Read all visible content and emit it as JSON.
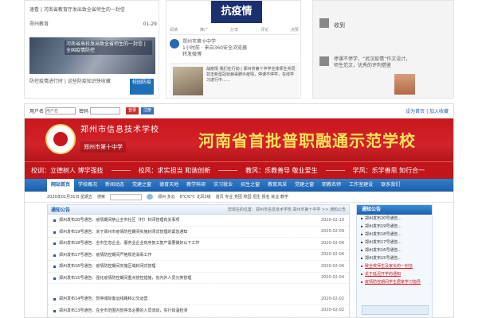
{
  "collage": {
    "panel1": {
      "news1_title": "速看 | 河南省教育厅发出致全省师生的一封信",
      "news1_meta_left": "郑州教育",
      "news1_meta_right": "01-29",
      "photo_caption": "河南省高校发出致全省师生的一封信 | 全国疫情防控",
      "news2_title": "防控疫情进行时 | 这些防疫知识快收藏",
      "thumb_label": "校园防疫"
    },
    "panel2": {
      "banner_text": "抗疫情",
      "actions": [
        "阅读",
        "推广",
        "分享",
        "评论",
        "点赞"
      ],
      "post_name": "郑州市第十中学",
      "post_meta": "1小时前 · 来自360安全浏览器",
      "post_sub": "转发微博",
      "content_text": "战疫情 我们在行动 | 郑州市第十中学全体师生共同抗击新型冠状病毒肺炎疫情，停课不停学，在线学习进行中……"
    },
    "panel3": {
      "chat1": "收到",
      "chat2": "停课不停学，“武汉疫情”作文设计，师生范文，优秀的评判借鉴"
    }
  },
  "site": {
    "loginbar": {
      "user_label": "用户名",
      "user_placeholder": "用户名",
      "pass_label": "密码",
      "login_btn": "登录",
      "register_btn": "注册",
      "right_links": "设为首页 | 加入收藏"
    },
    "header": {
      "school_name": "郑州市信息技术学校",
      "school_sub": "郑州市第十中学",
      "slogan": "河南省首批普职融通示范学校"
    },
    "motto": {
      "school_motto": "校训：立德树人  博学强技",
      "school_style": "校风：求实担当  和谐创新",
      "teach_style": "教风：乐教善导  敬业爱生",
      "study_style": "学风：乐学善思  知行合一"
    },
    "nav": [
      "网站首页",
      "学校概况",
      "新闻动态",
      "党建之窗",
      "德育天地",
      "教学科研",
      "实习就业",
      "招生之窗",
      "教育风采",
      "党建之窗",
      "职教名师",
      "工作室建设",
      "联系我们"
    ],
    "infobar": {
      "date": "2020年01月31日 星期五",
      "search_label": "搜索",
      "weather": "郑州 多云",
      "temp": "8℃/0℃ 北风3级",
      "links": "首页  专业  党团  校园  招生  报名  就业  教学"
    },
    "notices": {
      "title": "通知公告",
      "crumb": "您现在的位置：郑州市信息技术学校 郑州市第十中学 >> 通知公告",
      "rows": [
        {
          "text": "郑州发布20号通告：疫情期间禁止全市社区（村）封闭管理有关事项",
          "date": "2020-02-10"
        },
        {
          "text": "郑州发布19号通告：关于郑州市疫情防控期间实施封闭式管理的紧急通知",
          "date": "2020-02-09"
        },
        {
          "text": "郑州发布18号通告：全市生态企业、服务业企业有序复工复产需要做好以下工作",
          "date": "2020-02-08"
        },
        {
          "text": "郑州发布17号通告：疫情防控期间严格规范消毒工作",
          "date": "2020-02-06"
        },
        {
          "text": "郑州发布16号通告：疫情防控期间实施区域封闭式管理",
          "date": "2020-02-06"
        },
        {
          "text": "郑州发布15号通告：强化疫情防控期间重点管控措施，省内外人员分类管理",
          "date": "2020-02-04"
        },
        {
          "text": "郑州发布14号通告：暂停城际客运线路和公交运营",
          "date": "2020-02-02"
        },
        {
          "text": "郑州发布13号通告：在全市范围内暂停非必要的人员流动，实行体温检测",
          "date": "2020-02-02"
        }
      ]
    },
    "side": {
      "title": "通知公告",
      "rows": [
        {
          "text": "郑州发布20号通告...",
          "red": false
        },
        {
          "text": "郑州发布19号通告...",
          "red": false
        },
        {
          "text": "郑州发布18号通告...",
          "red": false
        },
        {
          "text": "郑州发布17号通告...",
          "red": false
        },
        {
          "text": "郑州发布16号通告...",
          "red": false
        },
        {
          "text": "郑州发布15号通告...",
          "red": false
        },
        {
          "text": "致全校师生及家长的一封信",
          "red": true
        },
        {
          "text": "关于延迟开学的通知",
          "red": true
        },
        {
          "text": "疫情防控期间学生居家学习指导",
          "red": true
        }
      ]
    },
    "colors": {
      "header_red": "#c8171c",
      "slogan_yellow": "#ffe15a",
      "nav_blue": "#1e5ea8"
    }
  }
}
